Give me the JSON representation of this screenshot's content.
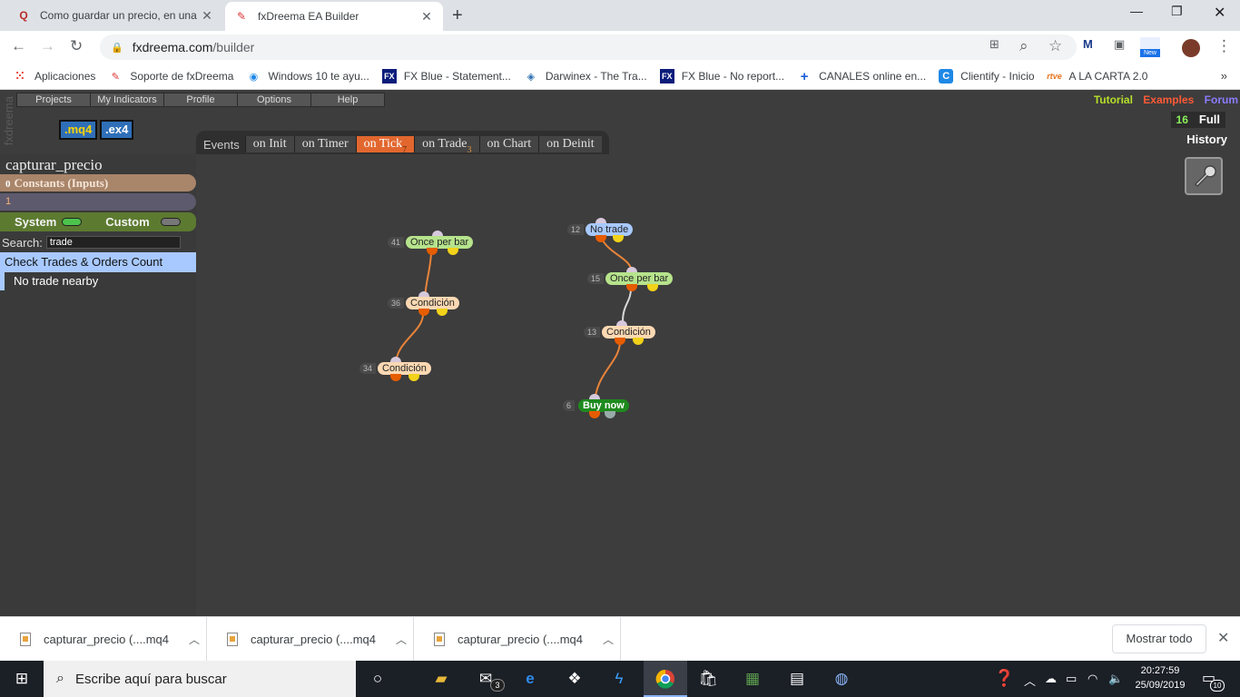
{
  "browser": {
    "tabs": [
      {
        "title": "Como guardar un precio, en una",
        "icon": "quora-icon",
        "active": false
      },
      {
        "title": "fxDreema EA Builder",
        "icon": "fxdreema-icon",
        "active": true
      }
    ],
    "url_host": "fxdreema.com",
    "url_path": "/builder",
    "bookmarks": [
      "Aplicaciones",
      "Soporte de fxDreema",
      "Windows 10 te ayu...",
      "FX Blue - Statement...",
      "Darwinex - The Tra...",
      "FX Blue - No report...",
      "CANALES online en...",
      "Clientify - Inicio",
      "A LA CARTA 2.0"
    ],
    "bookmarks_more": "»",
    "new_badge": "New"
  },
  "app": {
    "side_logo": "fxdreema",
    "menu": [
      "Projects",
      "My Indicators",
      "Profile",
      "Options",
      "Help"
    ],
    "top_links": {
      "tutorial": "Tutorial",
      "examples": "Examples",
      "forum": "Forum"
    },
    "file_buttons": {
      "mq4": ".mq4",
      "ex4": ".ex4"
    },
    "version_number": "16",
    "version_label": "Full",
    "history": "History",
    "events_label": "Events",
    "events": [
      {
        "label": "on Init",
        "badge": ""
      },
      {
        "label": "on Timer",
        "badge": ""
      },
      {
        "label": "on Tick",
        "badge": "7"
      },
      {
        "label": "on Trade",
        "badge": "3"
      },
      {
        "label": "on Chart",
        "badge": ""
      },
      {
        "label": "on Deinit",
        "badge": ""
      }
    ],
    "selected_event": "on Tick",
    "project_name": "capturar_precio",
    "constants_count": "0",
    "constants_label": "Constants (Inputs)",
    "variables_count": "1",
    "system_label": "System",
    "custom_label": "Custom",
    "search_label": "Search:",
    "search_value": "trade",
    "search_results": [
      "Check Trades & Orders Count",
      "No trade nearby"
    ],
    "blocks": [
      {
        "id": "41",
        "label": "Once per bar"
      },
      {
        "id": "36",
        "label": "Condición"
      },
      {
        "id": "34",
        "label": "Condición"
      },
      {
        "id": "12",
        "label": "No trade"
      },
      {
        "id": "15",
        "label": "Once per bar"
      },
      {
        "id": "13",
        "label": "Condición"
      },
      {
        "id": "6",
        "label": "Buy now"
      }
    ]
  },
  "downloads": {
    "items": [
      "capturar_precio (....mq4",
      "capturar_precio (....mq4",
      "capturar_precio (....mq4"
    ],
    "show_all": "Mostrar todo"
  },
  "taskbar": {
    "search_placeholder": "Escribe aquí para buscar",
    "mail_badge": "3",
    "time": "20:27:59",
    "date": "25/09/2019",
    "notifications": "10"
  },
  "colors": {
    "accent_selected_event": "#e2672f",
    "constants": "#a9856a",
    "system_bar": "#5c7a30",
    "search_highlight": "#a8c9ff",
    "once_per_bar": "#b6e38c",
    "condicion": "#fcd9b3",
    "no_trade": "#a8c9ff",
    "buy_now": "#1e8a1e"
  }
}
